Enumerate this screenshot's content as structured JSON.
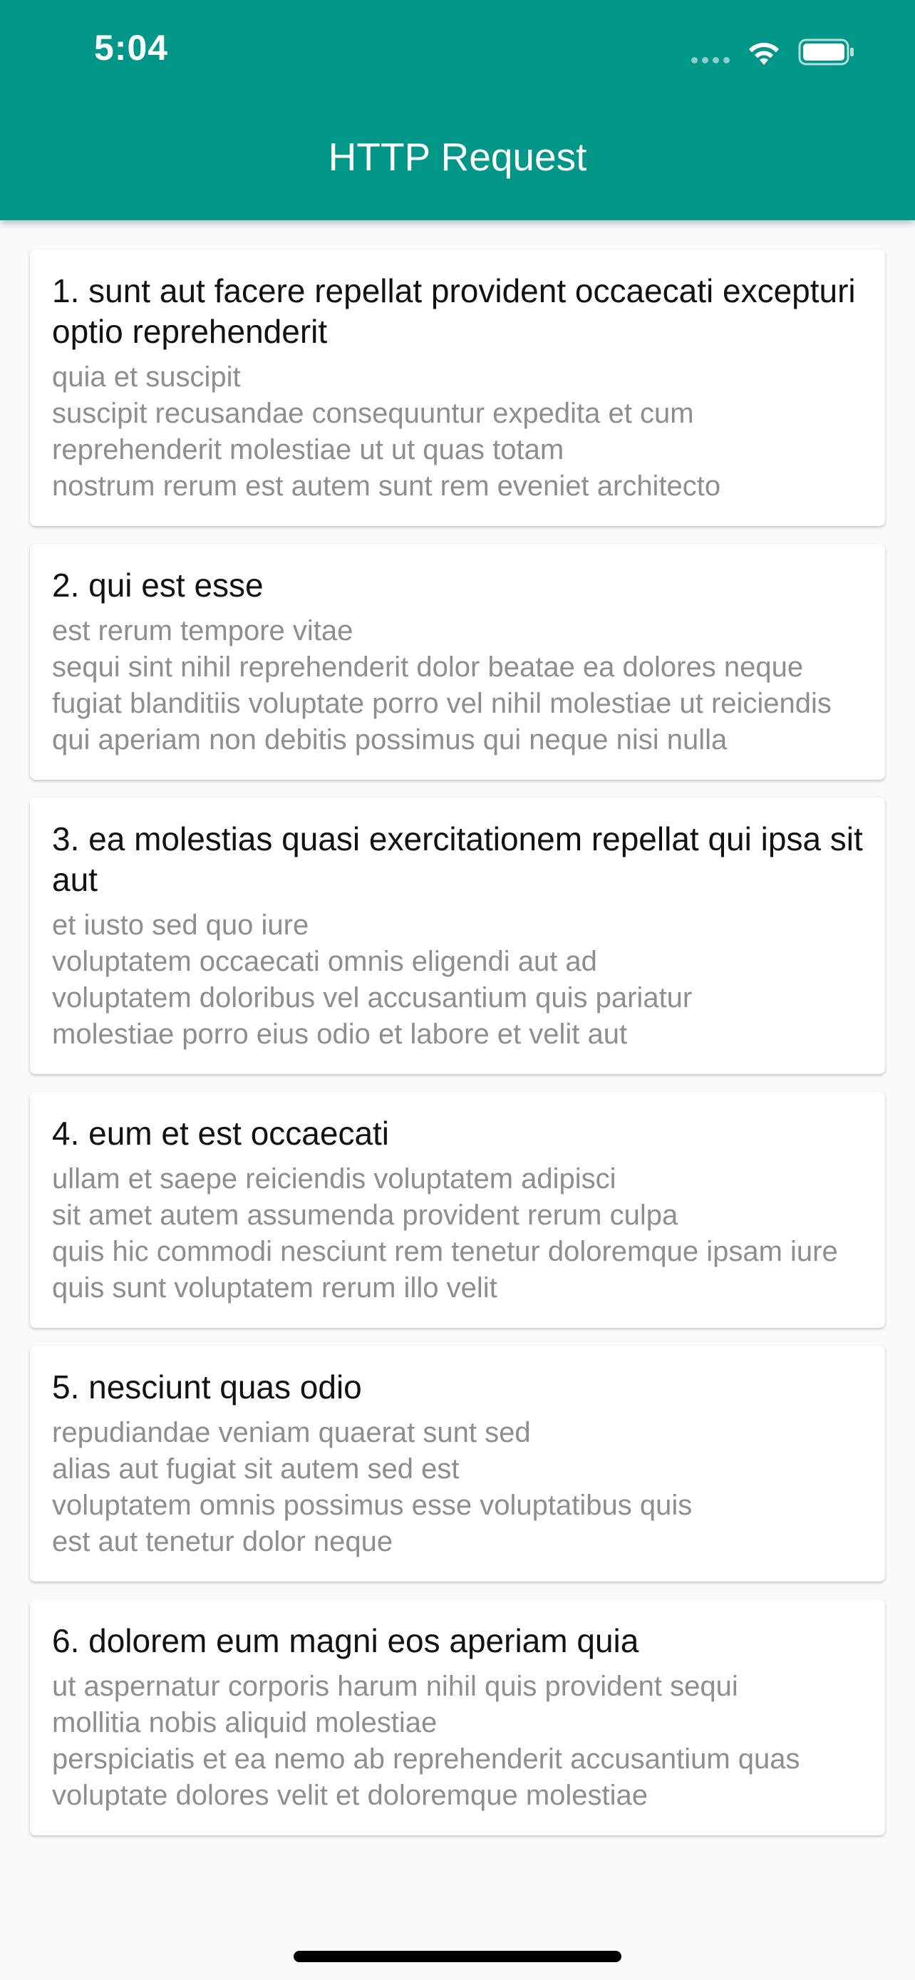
{
  "status_bar": {
    "time": "5:04"
  },
  "app_bar": {
    "title": "HTTP Request",
    "background_color": "#009688"
  },
  "posts": [
    {
      "title": "1. sunt aut facere repellat provident occaecati excepturi optio reprehenderit",
      "body": "quia et suscipit\nsuscipit recusandae consequuntur expedita et cum reprehenderit molestiae ut ut quas totam\nnostrum rerum est autem sunt rem eveniet architecto"
    },
    {
      "title": "2. qui est esse",
      "body": "est rerum tempore vitae\nsequi sint nihil reprehenderit dolor beatae ea dolores neque\nfugiat blanditiis voluptate porro vel nihil molestiae ut reiciendis\nqui aperiam non debitis possimus qui neque nisi nulla"
    },
    {
      "title": "3. ea molestias quasi exercitationem repellat qui ipsa sit aut",
      "body": "et iusto sed quo iure\nvoluptatem occaecati omnis eligendi aut ad\nvoluptatem doloribus vel accusantium quis pariatur\nmolestiae porro eius odio et labore et velit aut"
    },
    {
      "title": "4. eum et est occaecati",
      "body": "ullam et saepe reiciendis voluptatem adipisci\nsit amet autem assumenda provident rerum culpa\nquis hic commodi nesciunt rem tenetur doloremque ipsam iure\nquis sunt voluptatem rerum illo velit"
    },
    {
      "title": "5. nesciunt quas odio",
      "body": "repudiandae veniam quaerat sunt sed\nalias aut fugiat sit autem sed est\nvoluptatem omnis possimus esse voluptatibus quis\nest aut tenetur dolor neque"
    },
    {
      "title": "6. dolorem eum magni eos aperiam quia",
      "body": "ut aspernatur corporis harum nihil quis provident sequi\nmollitia nobis aliquid molestiae\nperspiciatis et ea nemo ab reprehenderit accusantium quas\nvoluptate dolores velit et doloremque molestiae"
    }
  ]
}
